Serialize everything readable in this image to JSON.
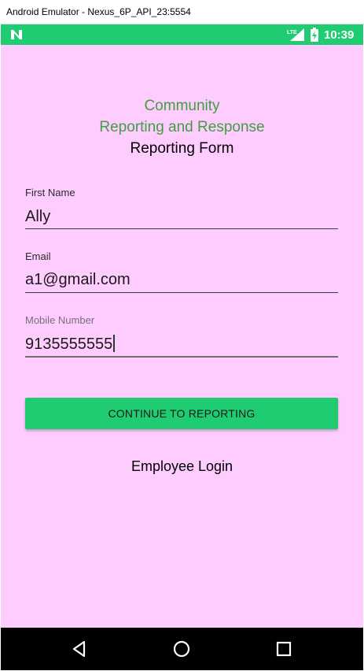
{
  "window": {
    "title": "Android Emulator - Nexus_6P_API_23:5554"
  },
  "status_bar": {
    "time": "10:39",
    "accent": "#20cc72",
    "icons": [
      "notification-n-icon",
      "lte-signal-icon",
      "battery-charging-icon"
    ]
  },
  "header": {
    "line1": "Community",
    "line2": "Reporting and Response",
    "line3": "Reporting Form",
    "green": "#3f9f3f"
  },
  "form": {
    "first_name": {
      "label": "First Name",
      "value": "Ally"
    },
    "email": {
      "label": "Email",
      "value": "a1@gmail.com"
    },
    "mobile": {
      "label": "Mobile Number",
      "value": "9135555555"
    }
  },
  "actions": {
    "continue_label": "CONTINUE TO REPORTING",
    "employee_login_label": "Employee Login"
  },
  "nav_bar": {
    "icons": [
      "back-icon",
      "home-icon",
      "recents-icon"
    ]
  },
  "colors": {
    "background": "#ffccff",
    "button": "#20cc72"
  }
}
